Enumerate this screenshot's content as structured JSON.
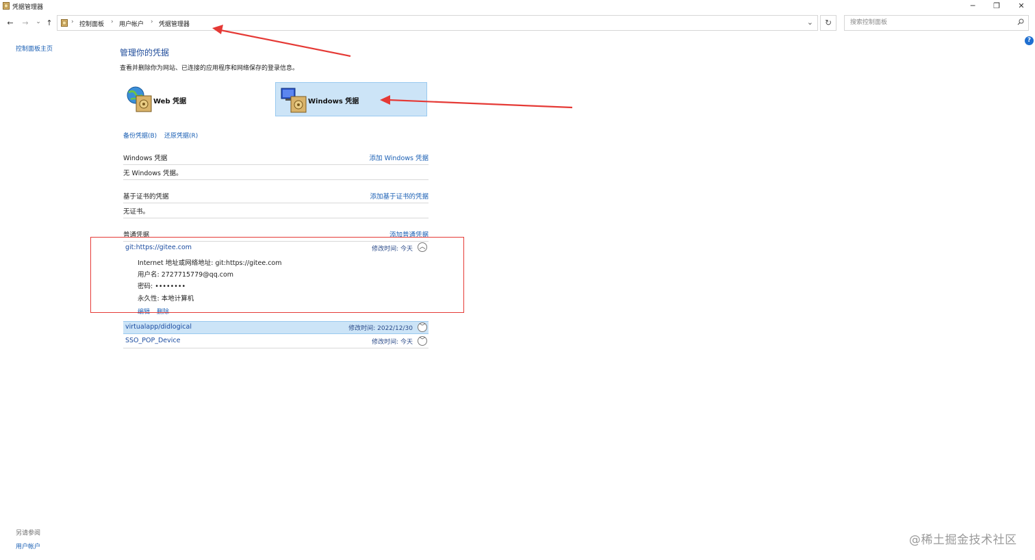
{
  "window": {
    "title": "凭据管理器",
    "controls": {
      "minimize": "─",
      "restore": "❐",
      "close": "✕"
    }
  },
  "nav": {
    "back": "←",
    "forward": "→",
    "recent": "⌄",
    "up": "↑",
    "breadcrumb": [
      "控制面板",
      "用户帐户",
      "凭据管理器"
    ],
    "crumb_sep": "›",
    "dropdown": "⌄",
    "refresh": "↻"
  },
  "search": {
    "placeholder": "搜索控制面板",
    "value": ""
  },
  "help_label": "?",
  "sidebar": {
    "home": "控制面板主页",
    "see_also": "另请参阅",
    "user_accounts": "用户帐户"
  },
  "main": {
    "title": "管理你的凭据",
    "description": "查看并删除你为网站、已连接的应用程序和网络保存的登录信息。",
    "categories": {
      "web": "Web 凭据",
      "windows": "Windows 凭据"
    },
    "backup": "备份凭据(B)",
    "restore": "还原凭据(R)",
    "sections": {
      "windows": {
        "title": "Windows 凭据",
        "add": "添加 Windows 凭据",
        "empty": "无 Windows 凭据。"
      },
      "cert": {
        "title": "基于证书的凭据",
        "add": "添加基于证书的凭据",
        "empty": "无证书。"
      },
      "generic": {
        "title": "普通凭据",
        "add": "添加普通凭据"
      }
    },
    "credentials": [
      {
        "name": "git:https://gitee.com",
        "modified": "修改时间:  今天",
        "expanded": true,
        "chevron": "︿",
        "details": {
          "address": "Internet 地址或网络地址:  git:https://gitee.com",
          "username": "用户名:  2727715779@qq.com",
          "password": "密码:  ••••••••",
          "persistence": "永久性:  本地计算机"
        },
        "edit": "编辑",
        "delete": "删除"
      },
      {
        "name": "virtualapp/didlogical",
        "modified": "修改时间:  2022/12/30",
        "selected": true,
        "chevron": "﹀"
      },
      {
        "name": "SSO_POP_Device",
        "modified": "修改时间:  今天",
        "chevron": "﹀"
      }
    ]
  },
  "watermark": "@稀土掘金技术社区",
  "colors": {
    "link": "#1a5fb4",
    "title": "#1e4b9a",
    "selected": "#cce4f7",
    "annotation": "#e53935"
  }
}
